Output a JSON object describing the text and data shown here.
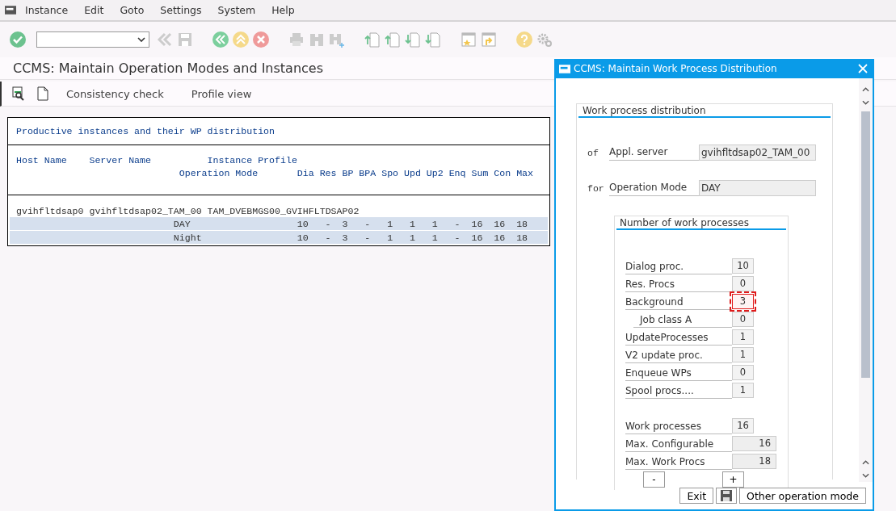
{
  "menu": [
    "Instance",
    "Edit",
    "Goto",
    "Settings",
    "System",
    "Help"
  ],
  "title": "CCMS: Maintain Operation Modes and Instances",
  "app_toolbar": [
    "Consistency check",
    "Profile view"
  ],
  "list": {
    "title": "Productive instances and their WP distribution",
    "headers": {
      "host": "Host Name",
      "server": "Server Name",
      "profile": "Instance Profile",
      "mode": "Operation Mode",
      "columns": [
        "Dia",
        "Res",
        "BP",
        "BPA",
        "Spo",
        "Upd",
        "Up2",
        "Enq",
        "Sum",
        "Con",
        "Max"
      ]
    },
    "instances": [
      {
        "host": "gvihfltdsap0",
        "server": "gvihfltdsap02_TAM_00",
        "profile": "TAM_DVEBMGS00_GVIHFLTDSAP02",
        "modes": [
          {
            "name": "DAY",
            "values": [
              "10",
              "-",
              "3",
              "-",
              "1",
              "1",
              "1",
              "-",
              "16",
              "16",
              "18"
            ]
          },
          {
            "name": "Night",
            "values": [
              "10",
              "-",
              "3",
              "-",
              "1",
              "1",
              "1",
              "-",
              "16",
              "16",
              "18"
            ]
          }
        ]
      }
    ]
  },
  "dialog": {
    "title": "CCMS: Maintain Work Process Distribution",
    "group_title": "Work process distribution",
    "fields": [
      {
        "prefix": "of",
        "label": "Appl. server",
        "value": "gvihfltdsap02_TAM_00"
      },
      {
        "prefix": "for",
        "label": "Operation Mode",
        "value": "DAY"
      }
    ],
    "subgroup_title": "Number of work processes",
    "rows": [
      {
        "label": "Dialog proc.",
        "value": "10",
        "kind": "input",
        "focused": false
      },
      {
        "label": "Res. Procs",
        "value": "0",
        "kind": "input",
        "focused": false
      },
      {
        "label": "Background",
        "value": "3",
        "kind": "input",
        "focused": true,
        "children": [
          {
            "label": "Job class A",
            "value": "0",
            "kind": "input",
            "focused": false
          }
        ]
      },
      {
        "label": "UpdateProcesses",
        "value": "1",
        "kind": "input",
        "focused": false
      },
      {
        "label": "V2 update proc.",
        "value": "1",
        "kind": "input",
        "focused": false
      },
      {
        "label": "Enqueue WPs",
        "value": "0",
        "kind": "input",
        "focused": false
      },
      {
        "label": "Spool procs....",
        "value": "1",
        "kind": "input",
        "focused": false
      }
    ],
    "totals": [
      {
        "label": "Work processes",
        "value": "16",
        "kind": "input",
        "focused": false
      },
      {
        "label": "Max. Configurable",
        "value": "16",
        "kind": "display",
        "focused": false
      },
      {
        "label": "Max. Work Procs",
        "value": "18",
        "kind": "display",
        "focused": false
      }
    ],
    "step_buttons": [
      "-",
      "+"
    ],
    "buttons": {
      "exit": "Exit",
      "other": "Other operation mode"
    }
  }
}
